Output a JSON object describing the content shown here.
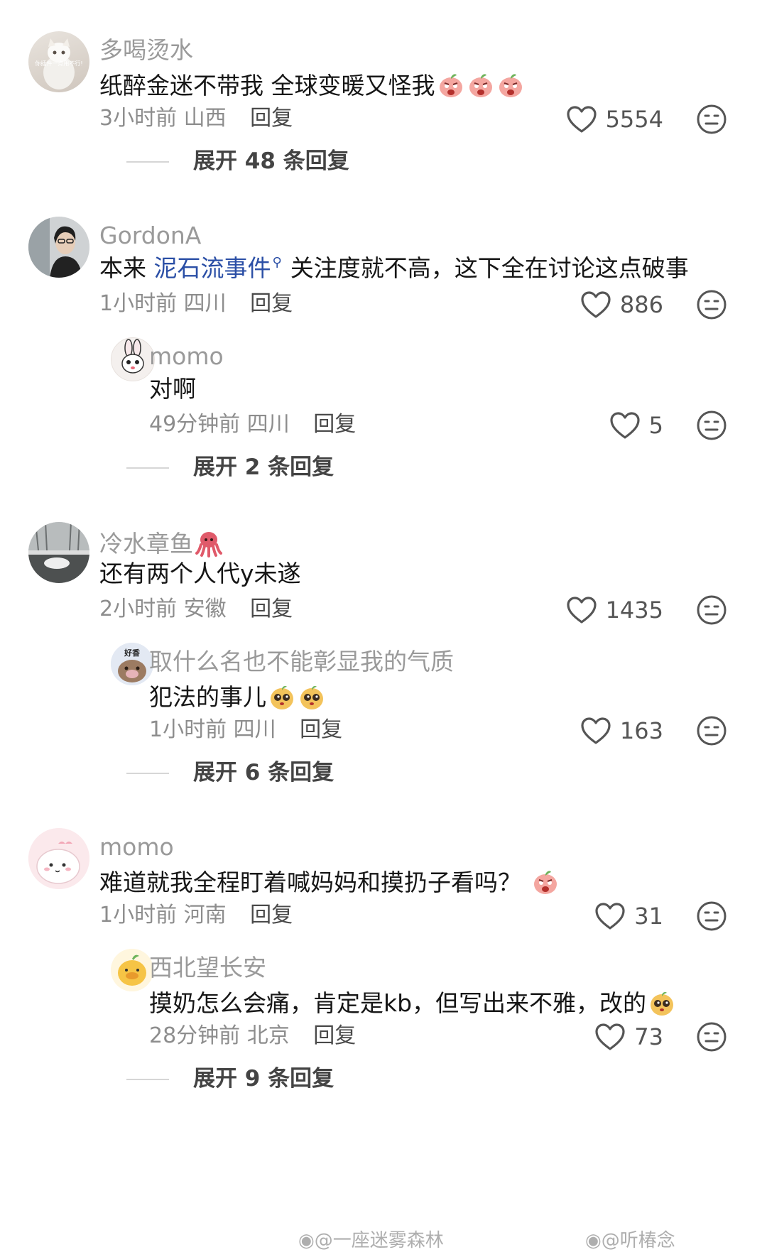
{
  "comments": [
    {
      "username": "多喝烫水",
      "avatar_caption": "你插件一点用不行!",
      "text": "纸醉金迷不带我 全球变暖又怪我",
      "meta": "3小时前 山西",
      "reply_label": "回复",
      "likes": "5554",
      "expand": "展开 48 条回复"
    },
    {
      "username": "GordonA",
      "text_before_link": "本来 ",
      "link_text": "泥石流事件",
      "text_after_link": "关注度就不高，这下全在讨论这点破事",
      "meta": "1小时前 四川",
      "reply_label": "回复",
      "likes": "886",
      "reply": {
        "username": "momo",
        "text": "对啊",
        "meta": "49分钟前 四川",
        "reply_label": "回复",
        "likes": "5"
      },
      "expand": "展开 2 条回复"
    },
    {
      "username": "冷水章鱼",
      "text": "还有两个人代y未遂",
      "meta": "2小时前 安徽",
      "reply_label": "回复",
      "likes": "1435",
      "reply": {
        "username": "取什么名也不能彰显我的气质",
        "avatar_caption": "好香",
        "text": "犯法的事儿",
        "meta": "1小时前 四川",
        "reply_label": "回复",
        "likes": "163"
      },
      "expand": "展开 6 条回复"
    },
    {
      "username": "momo",
      "text": "难道就我全程盯着喊妈妈和摸扔子看吗？",
      "meta": "1小时前 河南",
      "reply_label": "回复",
      "likes": "31",
      "reply": {
        "username": "西北望长安",
        "text": "摸奶怎么会痛，肯定是kb，但写出来不雅，改的",
        "meta": "28分钟前 北京",
        "reply_label": "回复",
        "likes": "73"
      },
      "expand": "展开 9 条回复"
    }
  ],
  "watermarks": [
    "@一座迷雾森林",
    "@听椿念"
  ],
  "icons": {
    "like": "heart-outline-icon",
    "dislike": "meh-face-icon",
    "search": "search-icon",
    "emoji_peach": "angry-peach-emoji",
    "emoji_mango": "mango-face-emoji",
    "emoji_octopus": "octopus-emoji",
    "weibo": "weibo-logo"
  },
  "colors": {
    "link": "#2b4fa6",
    "muted": "#9a9a9a",
    "text": "#161616"
  }
}
